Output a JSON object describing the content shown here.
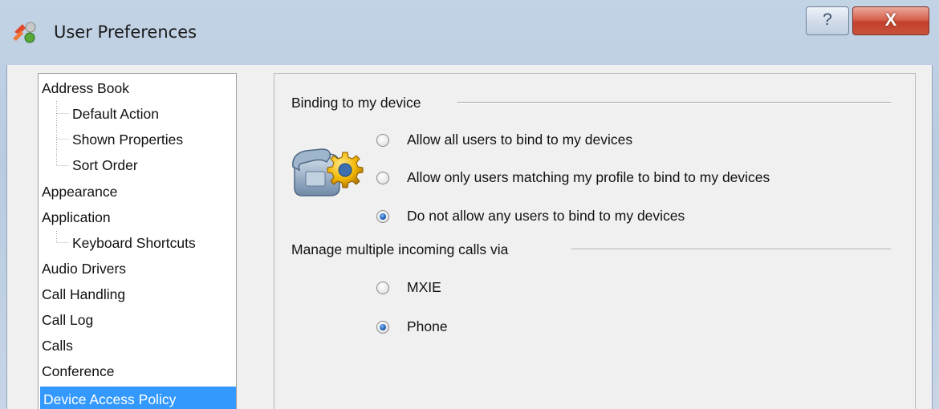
{
  "window": {
    "title": "User Preferences",
    "help_label": "?",
    "close_label": "X"
  },
  "sidebar": {
    "items": [
      {
        "label": "Address Book",
        "level": 0,
        "selected": false
      },
      {
        "label": "Default Action",
        "level": 1,
        "selected": false
      },
      {
        "label": "Shown Properties",
        "level": 1,
        "selected": false
      },
      {
        "label": "Sort Order",
        "level": 1,
        "selected": false
      },
      {
        "label": "Appearance",
        "level": 0,
        "selected": false
      },
      {
        "label": "Application",
        "level": 0,
        "selected": false
      },
      {
        "label": "Keyboard Shortcuts",
        "level": 1,
        "selected": false
      },
      {
        "label": "Audio Drivers",
        "level": 0,
        "selected": false
      },
      {
        "label": "Call Handling",
        "level": 0,
        "selected": false
      },
      {
        "label": "Call Log",
        "level": 0,
        "selected": false
      },
      {
        "label": "Calls",
        "level": 0,
        "selected": false
      },
      {
        "label": "Conference",
        "level": 0,
        "selected": false
      },
      {
        "label": "Device Access Policy",
        "level": 0,
        "selected": true
      }
    ]
  },
  "binding": {
    "title": "Binding to my device",
    "options": [
      {
        "label": "Allow all users to bind to my devices",
        "checked": false
      },
      {
        "label": "Allow only users matching my profile to bind to my devices",
        "checked": false
      },
      {
        "label": "Do not allow any users to bind to my devices",
        "checked": true
      }
    ]
  },
  "calls": {
    "title": "Manage multiple incoming calls via",
    "options": [
      {
        "label": "MXIE",
        "checked": false
      },
      {
        "label": "Phone",
        "checked": true
      }
    ]
  },
  "colors": {
    "selection": "#3399ff",
    "close_button": "#c9523d",
    "radio_checked": "#1f5fb0"
  },
  "icons": {
    "app": "app-logo-icon",
    "device": "phone-gear-icon"
  }
}
